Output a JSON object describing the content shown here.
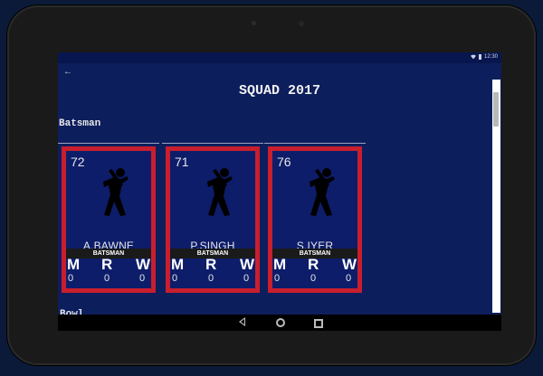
{
  "status_bar": {
    "time": "12:30"
  },
  "toolbar": {
    "back_icon": "arrow-left-icon"
  },
  "page": {
    "title": "SQUAD 2017"
  },
  "sections": [
    {
      "label": "Batsman"
    }
  ],
  "next_section_partial": "Bowl",
  "players": [
    {
      "rating": "72",
      "name": "A.BAWNE",
      "role": "BATSMAN",
      "stats": [
        {
          "label": "M",
          "value": "0"
        },
        {
          "label": "R",
          "value": "0"
        },
        {
          "label": "W",
          "value": "0"
        }
      ]
    },
    {
      "rating": "71",
      "name": "P.SINGH",
      "role": "BATSMAN",
      "stats": [
        {
          "label": "M",
          "value": "0"
        },
        {
          "label": "R",
          "value": "0"
        },
        {
          "label": "W",
          "value": "0"
        }
      ]
    },
    {
      "rating": "76",
      "name": "S.IYER",
      "role": "BATSMAN",
      "stats": [
        {
          "label": "M",
          "value": "0"
        },
        {
          "label": "R",
          "value": "0"
        },
        {
          "label": "W",
          "value": "0"
        }
      ]
    }
  ],
  "colors": {
    "card_border": "#c81e2e",
    "card_bg": "#0d1d6a",
    "screen_bg": "#0d1e5c"
  }
}
